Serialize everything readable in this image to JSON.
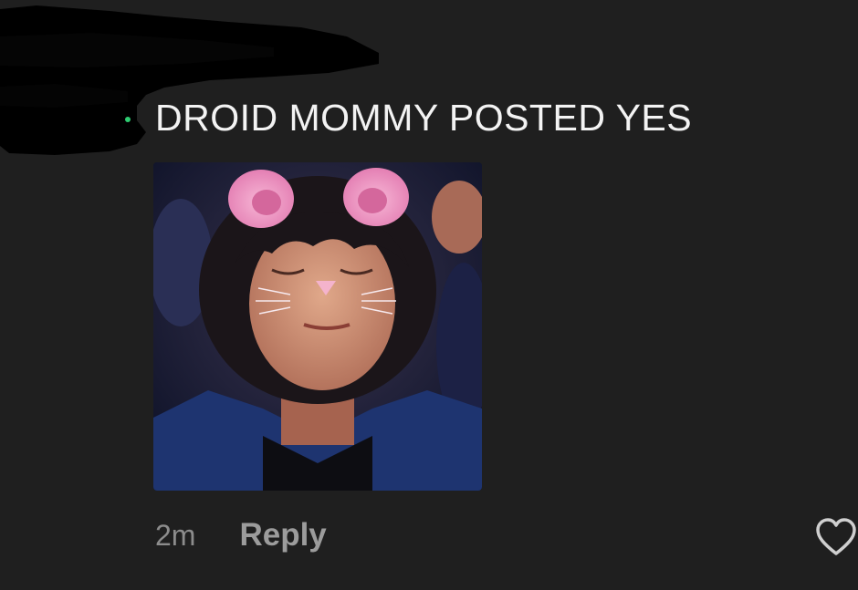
{
  "comment": {
    "text": "DROID MOMMY POSTED YES",
    "image_description_icon": "cat-filter-photo",
    "timestamp": "2m",
    "reply_label": "Reply"
  },
  "icons": {
    "like": "heart-outline-icon",
    "redaction": "redaction-scribble"
  },
  "colors": {
    "background": "#1f1f1f",
    "text": "#f3f3f3",
    "muted": "#8c8c8c",
    "icon": "#cfcfcf"
  }
}
